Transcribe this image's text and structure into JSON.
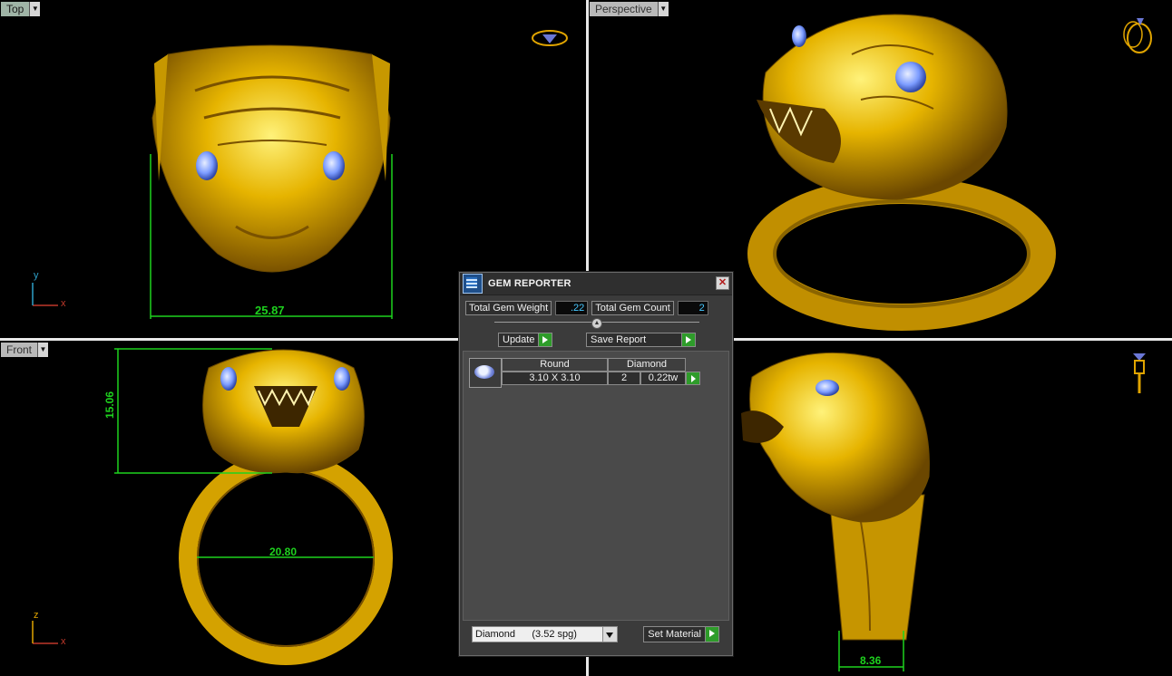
{
  "viewports": {
    "top": {
      "label": "Top",
      "dimension": "25.87"
    },
    "perspective": {
      "label": "Perspective"
    },
    "front": {
      "label": "Front",
      "dimension_height": "15.06",
      "dimension_inner": "20.80"
    },
    "side": {
      "dimension": "8.36"
    }
  },
  "axes": {
    "top_y": "y",
    "top_x": "x",
    "front_z": "z",
    "front_x": "x"
  },
  "gem_reporter": {
    "title": "GEM REPORTER",
    "close_label": "✕",
    "total_gem_weight_label": "Total Gem Weight",
    "total_gem_weight_value": ".22",
    "total_gem_count_label": "Total Gem Count",
    "total_gem_count_value": "2",
    "update_label": "Update",
    "save_report_label": "Save Report",
    "gems": [
      {
        "shape": "Round",
        "size": "3.10 X 3.10",
        "type": "Diamond",
        "count": "2",
        "weight": "0.22tw"
      }
    ],
    "material_select": "Diamond      (3.52 spg)",
    "set_material_label": "Set Material"
  },
  "colors": {
    "gold": "#d4a200",
    "dimension_green": "#1ed21e",
    "gem_blue": "#7c9cff"
  }
}
